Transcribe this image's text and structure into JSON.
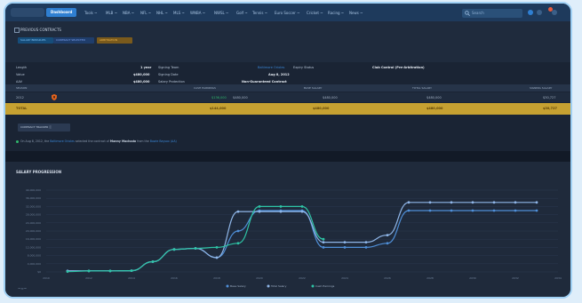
{
  "nav": {
    "dashboard": "Dashboard",
    "items": [
      "Tools ~",
      "MLB ~",
      "NBA ~",
      "NFL ~",
      "NHL ~",
      "MLS ~",
      "WNBA ~",
      "NWSL ~",
      "Golf ~",
      "Tennis ~",
      "Euro Soccer ~",
      "Cricket ~",
      "Racing ~",
      "News ~"
    ],
    "search_placeholder": "Search"
  },
  "contracts": {
    "section_title": "PREVIOUS CONTRACTS",
    "pills": [
      "SALARY BREAKUPS",
      "CONTRACT SELECTED",
      "ARBITRATION"
    ],
    "length_label": "Length",
    "length_value": "1 year",
    "value_label": "Value",
    "value_value": "$480,000",
    "aav_label": "AAV",
    "aav_value": "$480,000",
    "signing_team_label": "Signing Team",
    "signing_team_value": "Baltimore Orioles",
    "signing_date_label": "Signing Date",
    "signing_date_value": "Aug 8, 2012",
    "salary_protection_label": "Salary Protection",
    "salary_protection_value": "Non-Guaranteed Contract",
    "expiry_label": "Expiry Status",
    "expiry_value": "Club Control (Pre-Arbitration)"
  },
  "table": {
    "headers": [
      "SEASON",
      "CASH EARNINGS",
      "BASE SALARY",
      "TOTAL SALARY",
      "SIGNING SALARY"
    ],
    "row": {
      "season": "2012",
      "cash_earned": "$136,000",
      "cash_total": "$480,000",
      "base": "$480,000",
      "total": "$480,000",
      "signing": "$30,727"
    },
    "total_row": {
      "label": "TOTAL",
      "cash": "$144,000",
      "base": "$480,000",
      "total": "$480,000",
      "signing": "$30,727"
    }
  },
  "tracker_button": "CONTRACT TRACKER",
  "news": {
    "prefix": "On Aug 8, 2012, the",
    "team": "Baltimore Orioles",
    "mid": "selected the contract of",
    "player": "Manny Machado",
    "suffix": "from the",
    "affiliate": "Bowie Baysox (AA)"
  },
  "chart_title": "SALARY PROGRESSION",
  "chart_data": {
    "type": "line",
    "x": [
      2011,
      2012,
      2013,
      2014,
      2015,
      2016,
      2017,
      2018,
      2019,
      2020,
      2021,
      2022,
      2023,
      2024,
      2025,
      2026,
      2027,
      2028,
      2029,
      2030,
      2031,
      2032,
      2033
    ],
    "ylim": [
      0,
      40000000
    ],
    "yticks": [
      "$0",
      "4,000,000",
      "8,000,000",
      "12,000,000",
      "16,000,000",
      "20,000,000",
      "24,000,000",
      "28,000,000",
      "32,000,000",
      "36,000,000",
      "40,000,000"
    ],
    "xticks": [
      "2010",
      "2012",
      "2014",
      "2016",
      "2018",
      "2020",
      "2022",
      "2024",
      "2026",
      "2028",
      "2030",
      "2032",
      "2034"
    ],
    "series": [
      {
        "name": "Base Salary",
        "color": "#4f8fd8",
        "values": [
          480000,
          480000,
          500000,
          600000,
          5000000,
          11000000,
          11500000,
          7000000,
          20000000,
          30000000,
          30000000,
          30000000,
          12000000,
          12000000,
          12000000,
          14000000,
          30000000,
          30000000,
          30000000,
          30000000,
          30000000,
          30000000,
          30000000
        ]
      },
      {
        "name": "Total Salary",
        "color": "#8fb6e8",
        "values": [
          480000,
          480000,
          500000,
          600000,
          5000000,
          11000000,
          11500000,
          7000000,
          29500000,
          29500000,
          29500000,
          29500000,
          14500000,
          14500000,
          14500000,
          18000000,
          34000000,
          34000000,
          34000000,
          34000000,
          34000000,
          34000000,
          34000000
        ]
      },
      {
        "name": "Cash Earnings",
        "color": "#2ec4a6",
        "values": [
          136000,
          480000,
          500000,
          600000,
          5000000,
          11000000,
          11500000,
          12000000,
          14000000,
          32000000,
          32000000,
          32000000,
          16000000
        ]
      }
    ]
  }
}
